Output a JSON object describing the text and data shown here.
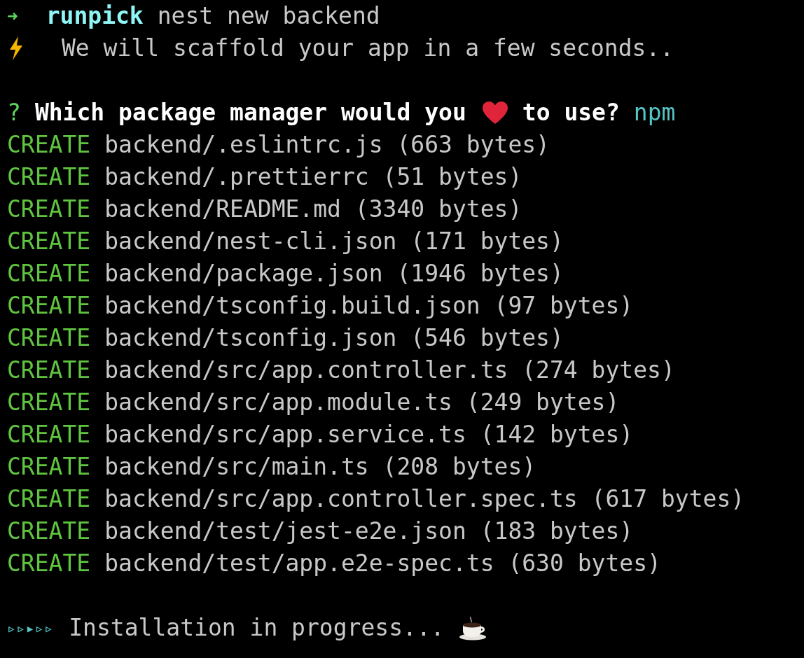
{
  "command": {
    "prompt": "➜",
    "directory": "runpick",
    "text": "nest new backend"
  },
  "notice": {
    "text": "We will scaffold your app in a few seconds.."
  },
  "question": {
    "mark": "?",
    "before": "Which package manager would you",
    "after": "to use?",
    "answer": "npm"
  },
  "created_files": [
    {
      "action": "CREATE",
      "text": "backend/.eslintrc.js (663 bytes)"
    },
    {
      "action": "CREATE",
      "text": "backend/.prettierrc (51 bytes)"
    },
    {
      "action": "CREATE",
      "text": "backend/README.md (3340 bytes)"
    },
    {
      "action": "CREATE",
      "text": "backend/nest-cli.json (171 bytes)"
    },
    {
      "action": "CREATE",
      "text": "backend/package.json (1946 bytes)"
    },
    {
      "action": "CREATE",
      "text": "backend/tsconfig.build.json (97 bytes)"
    },
    {
      "action": "CREATE",
      "text": "backend/tsconfig.json (546 bytes)"
    },
    {
      "action": "CREATE",
      "text": "backend/src/app.controller.ts (274 bytes)"
    },
    {
      "action": "CREATE",
      "text": "backend/src/app.module.ts (249 bytes)"
    },
    {
      "action": "CREATE",
      "text": "backend/src/app.service.ts (142 bytes)"
    },
    {
      "action": "CREATE",
      "text": "backend/src/main.ts (208 bytes)"
    },
    {
      "action": "CREATE",
      "text": "backend/src/app.controller.spec.ts (617 bytes)"
    },
    {
      "action": "CREATE",
      "text": "backend/test/jest-e2e.json (183 bytes)"
    },
    {
      "action": "CREATE",
      "text": "backend/test/app.e2e-spec.ts (630 bytes)"
    }
  ],
  "progress": {
    "spinner": "▹▹▸▹▹",
    "text": "Installation in progress..."
  }
}
